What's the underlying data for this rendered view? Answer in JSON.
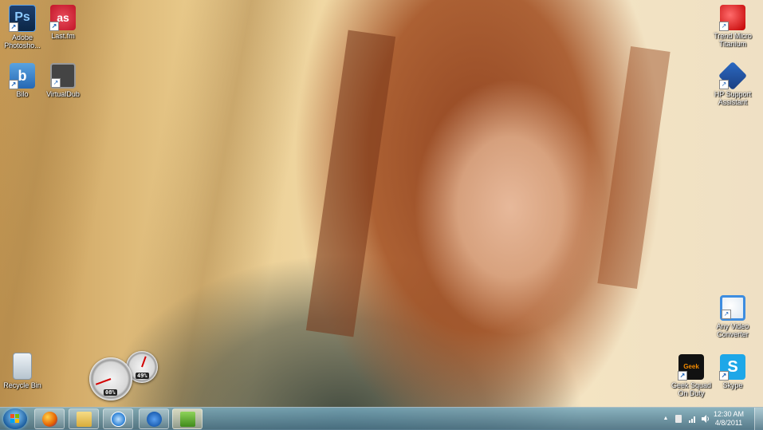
{
  "desktop": {
    "icons_left": [
      {
        "label": "Adobe Photosho...",
        "glyph": "Ps"
      },
      {
        "label": "Last.fm",
        "glyph": "as"
      },
      {
        "label": "Bilo",
        "glyph": "b"
      },
      {
        "label": "VirtualDub",
        "glyph": ""
      },
      {
        "label": "Recycle Bin",
        "glyph": ""
      }
    ],
    "icons_right": [
      {
        "label": "Trend Micro Titanium",
        "glyph": ""
      },
      {
        "label": "HP Support Assistant",
        "glyph": ""
      },
      {
        "label": "Any Video Converter",
        "glyph": ""
      },
      {
        "label": "Geek Squad On Duty",
        "glyph": "Geek"
      },
      {
        "label": "Skype",
        "glyph": "S"
      }
    ],
    "shortcut_arrow": "↗"
  },
  "gadget": {
    "cpu_reading": "08%",
    "memory_reading": "49%"
  },
  "taskbar": {
    "pinned": [
      {
        "name": "firefox-icon",
        "color": "#e66000"
      },
      {
        "name": "explorer-folder-icon",
        "color": "#e7c45a"
      },
      {
        "name": "itunes-icon",
        "color": "#2a7fd4"
      },
      {
        "name": "hp-icon",
        "color": "#1c5fb3"
      },
      {
        "name": "network-app-icon",
        "color": "#5fb030"
      }
    ],
    "tray": {
      "expand_arrow": "▲",
      "clock_time": "12:30 AM",
      "clock_date": "4/8/2011"
    }
  }
}
